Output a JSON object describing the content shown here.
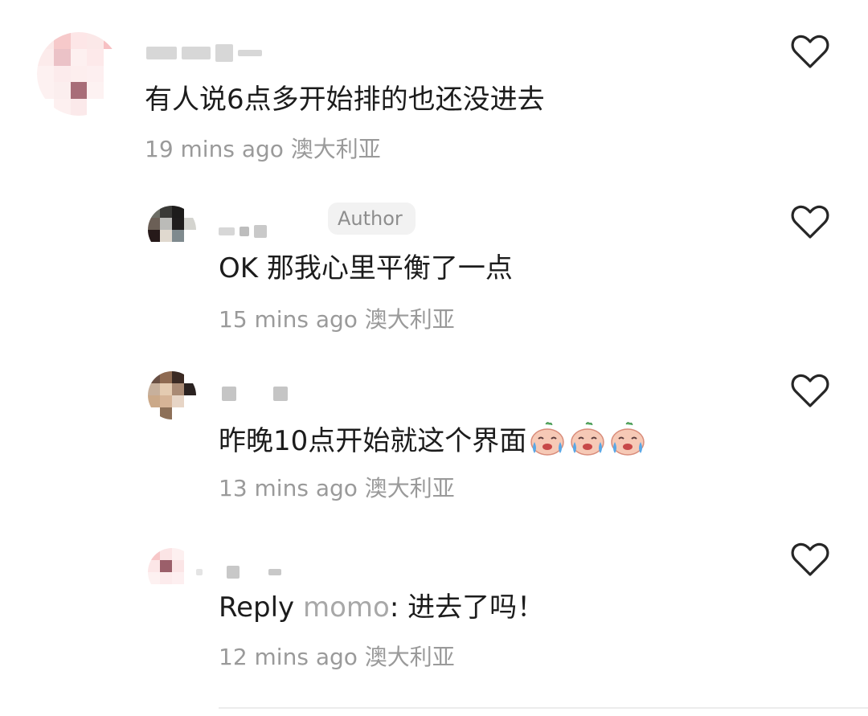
{
  "comments": [
    {
      "content": "有人说6点多开始排的也还没进去",
      "time": "19 mins ago",
      "location": "澳大利亚",
      "like_icon": "heart-outline-icon"
    },
    {
      "author_badge": "Author",
      "content": "OK 那我心里平衡了一点",
      "time": "15 mins ago",
      "location": "澳大利亚",
      "like_icon": "heart-outline-icon"
    },
    {
      "content": "昨晚10点开始就这个界面",
      "emojis": [
        "crying-face-emoji",
        "crying-face-emoji",
        "crying-face-emoji"
      ],
      "time": "13 mins ago",
      "location": "澳大利亚",
      "like_icon": "heart-outline-icon"
    },
    {
      "reply_prefix": "Reply",
      "reply_to": "momo",
      "reply_sep": ":",
      "content": "进去了吗！",
      "time": "12 mins ago",
      "location": "澳大利亚",
      "like_icon": "heart-outline-icon"
    }
  ],
  "colors": {
    "text": "#1c1c1c",
    "muted": "#9a9a9a",
    "reply_name": "#a8a8a8",
    "badge_bg": "#f2f2f2"
  }
}
